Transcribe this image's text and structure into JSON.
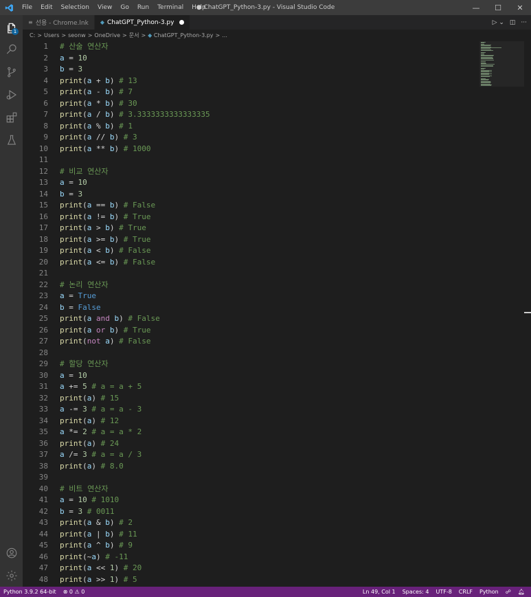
{
  "window": {
    "title": "● ChatGPT_Python-3.py - Visual Studio Code",
    "menu": [
      "File",
      "Edit",
      "Selection",
      "View",
      "Go",
      "Run",
      "Terminal",
      "Help"
    ],
    "controls": [
      "—",
      "☐",
      "✕"
    ]
  },
  "tabs": [
    {
      "label": "선용 - Chrome.lnk",
      "icon": "list-icon"
    },
    {
      "label": "ChatGPT_Python-3.py",
      "icon": "python-icon",
      "modified": true
    }
  ],
  "tab_actions": [
    "▷ ⌄",
    "◫",
    "···"
  ],
  "breadcrumb": [
    "C:",
    "Users",
    "seonw",
    "OneDrive",
    "문서",
    "ChatGPT_Python-3.py",
    "..."
  ],
  "activity": {
    "explorer_badge": "1"
  },
  "code_lines": [
    {
      "n": "1",
      "t": [
        [
          "cmt",
          "# 산술 연산자"
        ]
      ]
    },
    {
      "n": "2",
      "t": [
        [
          "var",
          "a"
        ],
        [
          "op",
          " = "
        ],
        [
          "num",
          "10"
        ]
      ]
    },
    {
      "n": "3",
      "t": [
        [
          "var",
          "b"
        ],
        [
          "op",
          " = "
        ],
        [
          "num",
          "3"
        ]
      ]
    },
    {
      "n": "4",
      "t": [
        [
          "fn",
          "print"
        ],
        [
          "op",
          "("
        ],
        [
          "var",
          "a"
        ],
        [
          "op",
          " + "
        ],
        [
          "var",
          "b"
        ],
        [
          "op",
          ") "
        ],
        [
          "cmt",
          "# 13"
        ]
      ]
    },
    {
      "n": "5",
      "t": [
        [
          "fn",
          "print"
        ],
        [
          "op",
          "("
        ],
        [
          "var",
          "a"
        ],
        [
          "op",
          " - "
        ],
        [
          "var",
          "b"
        ],
        [
          "op",
          ") "
        ],
        [
          "cmt",
          "# 7"
        ]
      ]
    },
    {
      "n": "6",
      "t": [
        [
          "fn",
          "print"
        ],
        [
          "op",
          "("
        ],
        [
          "var",
          "a"
        ],
        [
          "op",
          " * "
        ],
        [
          "var",
          "b"
        ],
        [
          "op",
          ") "
        ],
        [
          "cmt",
          "# 30"
        ]
      ]
    },
    {
      "n": "7",
      "t": [
        [
          "fn",
          "print"
        ],
        [
          "op",
          "("
        ],
        [
          "var",
          "a"
        ],
        [
          "op",
          " / "
        ],
        [
          "var",
          "b"
        ],
        [
          "op",
          ") "
        ],
        [
          "cmt",
          "# 3.3333333333333335"
        ]
      ]
    },
    {
      "n": "8",
      "t": [
        [
          "fn",
          "print"
        ],
        [
          "op",
          "("
        ],
        [
          "var",
          "a"
        ],
        [
          "op",
          " % "
        ],
        [
          "var",
          "b"
        ],
        [
          "op",
          ") "
        ],
        [
          "cmt",
          "# 1"
        ]
      ]
    },
    {
      "n": "9",
      "t": [
        [
          "fn",
          "print"
        ],
        [
          "op",
          "("
        ],
        [
          "var",
          "a"
        ],
        [
          "op",
          " // "
        ],
        [
          "var",
          "b"
        ],
        [
          "op",
          ") "
        ],
        [
          "cmt",
          "# 3"
        ]
      ]
    },
    {
      "n": "10",
      "t": [
        [
          "fn",
          "print"
        ],
        [
          "op",
          "("
        ],
        [
          "var",
          "a"
        ],
        [
          "op",
          " ** "
        ],
        [
          "var",
          "b"
        ],
        [
          "op",
          ") "
        ],
        [
          "cmt",
          "# 1000"
        ]
      ]
    },
    {
      "n": "11",
      "t": []
    },
    {
      "n": "12",
      "t": [
        [
          "cmt",
          "# 비교 연산자"
        ]
      ]
    },
    {
      "n": "13",
      "t": [
        [
          "var",
          "a"
        ],
        [
          "op",
          " = "
        ],
        [
          "num",
          "10"
        ]
      ]
    },
    {
      "n": "14",
      "t": [
        [
          "var",
          "b"
        ],
        [
          "op",
          " = "
        ],
        [
          "num",
          "3"
        ]
      ]
    },
    {
      "n": "15",
      "t": [
        [
          "fn",
          "print"
        ],
        [
          "op",
          "("
        ],
        [
          "var",
          "a"
        ],
        [
          "op",
          " == "
        ],
        [
          "var",
          "b"
        ],
        [
          "op",
          ") "
        ],
        [
          "cmt",
          "# False"
        ]
      ]
    },
    {
      "n": "16",
      "t": [
        [
          "fn",
          "print"
        ],
        [
          "op",
          "("
        ],
        [
          "var",
          "a"
        ],
        [
          "op",
          " != "
        ],
        [
          "var",
          "b"
        ],
        [
          "op",
          ") "
        ],
        [
          "cmt",
          "# True"
        ]
      ]
    },
    {
      "n": "17",
      "t": [
        [
          "fn",
          "print"
        ],
        [
          "op",
          "("
        ],
        [
          "var",
          "a"
        ],
        [
          "op",
          " > "
        ],
        [
          "var",
          "b"
        ],
        [
          "op",
          ") "
        ],
        [
          "cmt",
          "# True"
        ]
      ]
    },
    {
      "n": "18",
      "t": [
        [
          "fn",
          "print"
        ],
        [
          "op",
          "("
        ],
        [
          "var",
          "a"
        ],
        [
          "op",
          " >= "
        ],
        [
          "var",
          "b"
        ],
        [
          "op",
          ") "
        ],
        [
          "cmt",
          "# True"
        ]
      ]
    },
    {
      "n": "19",
      "t": [
        [
          "fn",
          "print"
        ],
        [
          "op",
          "("
        ],
        [
          "var",
          "a"
        ],
        [
          "op",
          " < "
        ],
        [
          "var",
          "b"
        ],
        [
          "op",
          ") "
        ],
        [
          "cmt",
          "# False"
        ]
      ]
    },
    {
      "n": "20",
      "t": [
        [
          "fn",
          "print"
        ],
        [
          "op",
          "("
        ],
        [
          "var",
          "a"
        ],
        [
          "op",
          " <= "
        ],
        [
          "var",
          "b"
        ],
        [
          "op",
          ") "
        ],
        [
          "cmt",
          "# False"
        ]
      ]
    },
    {
      "n": "21",
      "t": []
    },
    {
      "n": "22",
      "t": [
        [
          "cmt",
          "# 논리 연산자"
        ]
      ]
    },
    {
      "n": "23",
      "t": [
        [
          "var",
          "a"
        ],
        [
          "op",
          " = "
        ],
        [
          "const",
          "True"
        ]
      ]
    },
    {
      "n": "24",
      "t": [
        [
          "var",
          "b"
        ],
        [
          "op",
          " = "
        ],
        [
          "const",
          "False"
        ]
      ]
    },
    {
      "n": "25",
      "t": [
        [
          "fn",
          "print"
        ],
        [
          "op",
          "("
        ],
        [
          "var",
          "a"
        ],
        [
          "op",
          " "
        ],
        [
          "kw",
          "and"
        ],
        [
          "op",
          " "
        ],
        [
          "var",
          "b"
        ],
        [
          "op",
          ") "
        ],
        [
          "cmt",
          "# False"
        ]
      ]
    },
    {
      "n": "26",
      "t": [
        [
          "fn",
          "print"
        ],
        [
          "op",
          "("
        ],
        [
          "var",
          "a"
        ],
        [
          "op",
          " "
        ],
        [
          "kw",
          "or"
        ],
        [
          "op",
          " "
        ],
        [
          "var",
          "b"
        ],
        [
          "op",
          ") "
        ],
        [
          "cmt",
          "# True"
        ]
      ]
    },
    {
      "n": "27",
      "t": [
        [
          "fn",
          "print"
        ],
        [
          "op",
          "("
        ],
        [
          "kw",
          "not"
        ],
        [
          "op",
          " "
        ],
        [
          "var",
          "a"
        ],
        [
          "op",
          ") "
        ],
        [
          "cmt",
          "# False"
        ]
      ]
    },
    {
      "n": "28",
      "t": []
    },
    {
      "n": "29",
      "t": [
        [
          "cmt",
          "# 할당 연산자"
        ]
      ]
    },
    {
      "n": "30",
      "t": [
        [
          "var",
          "a"
        ],
        [
          "op",
          " = "
        ],
        [
          "num",
          "10"
        ]
      ]
    },
    {
      "n": "31",
      "t": [
        [
          "var",
          "a"
        ],
        [
          "op",
          " += "
        ],
        [
          "num",
          "5"
        ],
        [
          "op",
          " "
        ],
        [
          "cmt",
          "# a = a + 5"
        ]
      ]
    },
    {
      "n": "32",
      "t": [
        [
          "fn",
          "print"
        ],
        [
          "op",
          "("
        ],
        [
          "var",
          "a"
        ],
        [
          "op",
          ") "
        ],
        [
          "cmt",
          "# 15"
        ]
      ]
    },
    {
      "n": "33",
      "t": [
        [
          "var",
          "a"
        ],
        [
          "op",
          " -= "
        ],
        [
          "num",
          "3"
        ],
        [
          "op",
          " "
        ],
        [
          "cmt",
          "# a = a - 3"
        ]
      ]
    },
    {
      "n": "34",
      "t": [
        [
          "fn",
          "print"
        ],
        [
          "op",
          "("
        ],
        [
          "var",
          "a"
        ],
        [
          "op",
          ") "
        ],
        [
          "cmt",
          "# 12"
        ]
      ]
    },
    {
      "n": "35",
      "t": [
        [
          "var",
          "a"
        ],
        [
          "op",
          " *= "
        ],
        [
          "num",
          "2"
        ],
        [
          "op",
          " "
        ],
        [
          "cmt",
          "# a = a * 2"
        ]
      ]
    },
    {
      "n": "36",
      "t": [
        [
          "fn",
          "print"
        ],
        [
          "op",
          "("
        ],
        [
          "var",
          "a"
        ],
        [
          "op",
          ") "
        ],
        [
          "cmt",
          "# 24"
        ]
      ]
    },
    {
      "n": "37",
      "t": [
        [
          "var",
          "a"
        ],
        [
          "op",
          " /= "
        ],
        [
          "num",
          "3"
        ],
        [
          "op",
          " "
        ],
        [
          "cmt",
          "# a = a / 3"
        ]
      ]
    },
    {
      "n": "38",
      "t": [
        [
          "fn",
          "print"
        ],
        [
          "op",
          "("
        ],
        [
          "var",
          "a"
        ],
        [
          "op",
          ") "
        ],
        [
          "cmt",
          "# 8.0"
        ]
      ]
    },
    {
      "n": "39",
      "t": []
    },
    {
      "n": "40",
      "t": [
        [
          "cmt",
          "# 비트 연산자"
        ]
      ]
    },
    {
      "n": "41",
      "t": [
        [
          "var",
          "a"
        ],
        [
          "op",
          " = "
        ],
        [
          "num",
          "10"
        ],
        [
          "op",
          " "
        ],
        [
          "cmt",
          "# 1010"
        ]
      ]
    },
    {
      "n": "42",
      "t": [
        [
          "var",
          "b"
        ],
        [
          "op",
          " = "
        ],
        [
          "num",
          "3"
        ],
        [
          "op",
          " "
        ],
        [
          "cmt",
          "# 0011"
        ]
      ]
    },
    {
      "n": "43",
      "t": [
        [
          "fn",
          "print"
        ],
        [
          "op",
          "("
        ],
        [
          "var",
          "a"
        ],
        [
          "op",
          " & "
        ],
        [
          "var",
          "b"
        ],
        [
          "op",
          ") "
        ],
        [
          "cmt",
          "# 2"
        ]
      ]
    },
    {
      "n": "44",
      "t": [
        [
          "fn",
          "print"
        ],
        [
          "op",
          "("
        ],
        [
          "var",
          "a"
        ],
        [
          "op",
          " | "
        ],
        [
          "var",
          "b"
        ],
        [
          "op",
          ") "
        ],
        [
          "cmt",
          "# 11"
        ]
      ]
    },
    {
      "n": "45",
      "t": [
        [
          "fn",
          "print"
        ],
        [
          "op",
          "("
        ],
        [
          "var",
          "a"
        ],
        [
          "op",
          " ^ "
        ],
        [
          "var",
          "b"
        ],
        [
          "op",
          ") "
        ],
        [
          "cmt",
          "# 9"
        ]
      ]
    },
    {
      "n": "46",
      "t": [
        [
          "fn",
          "print"
        ],
        [
          "op",
          "(~"
        ],
        [
          "var",
          "a"
        ],
        [
          "op",
          ") "
        ],
        [
          "cmt",
          "# -11"
        ]
      ]
    },
    {
      "n": "47",
      "t": [
        [
          "fn",
          "print"
        ],
        [
          "op",
          "("
        ],
        [
          "var",
          "a"
        ],
        [
          "op",
          " << "
        ],
        [
          "num",
          "1"
        ],
        [
          "op",
          ") "
        ],
        [
          "cmt",
          "# 20"
        ]
      ]
    },
    {
      "n": "48",
      "t": [
        [
          "fn",
          "print"
        ],
        [
          "op",
          "("
        ],
        [
          "var",
          "a"
        ],
        [
          "op",
          " >> "
        ],
        [
          "num",
          "1"
        ],
        [
          "op",
          ") "
        ],
        [
          "cmt",
          "# 5"
        ]
      ]
    }
  ],
  "status": {
    "interpreter": "Python 3.9.2 64-bit",
    "problems": "⊗ 0 ⚠ 0",
    "position": "Ln 49, Col 1",
    "spaces": "Spaces: 4",
    "encoding": "UTF-8",
    "eol": "CRLF",
    "language": "Python"
  },
  "colors": {
    "statusbar": "#68217a",
    "editor_bg": "#1e1e1e",
    "activitybar": "#333333",
    "titlebar": "#3c3c3c"
  }
}
